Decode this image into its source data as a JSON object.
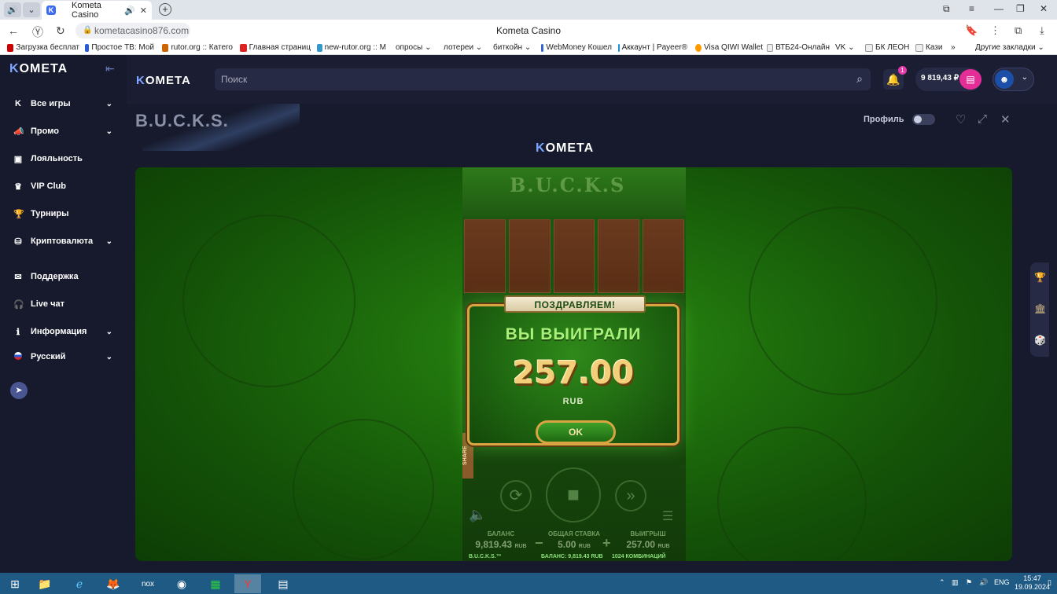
{
  "browser": {
    "tab_title": "Kometa Casino",
    "url": "kometacasino876.com",
    "page_title": "Kometa Casino",
    "bookmarks": [
      "Загрузка бесплат",
      "Простое ТВ: Мой",
      "rutor.org :: Катего",
      "Главная страниц",
      "new-rutor.org :: М",
      "опросы",
      "лотереи",
      "биткойн",
      "WebMoney Кошел",
      "Аккаунт | Payeer®",
      "Visa QIWI Wallet",
      "ВТБ24-Онлайн",
      "VK",
      "БК ЛЕОН",
      "Кази",
      "Другие закладки"
    ]
  },
  "brand": {
    "name_pre": "K",
    "name_rest": "OMETA"
  },
  "sidebar": {
    "items": [
      {
        "label": "Все игры",
        "icon": "kometa-k-icon"
      },
      {
        "label": "Промо",
        "icon": "megaphone-icon"
      },
      {
        "label": "Лояльность",
        "icon": "loyalty-icon"
      },
      {
        "label": "VIP Club",
        "icon": "crown-icon"
      },
      {
        "label": "Турниры",
        "icon": "trophy-icon"
      },
      {
        "label": "Криптовалюта",
        "icon": "crypto-icon"
      },
      {
        "label": "Поддержка",
        "icon": "support-icon"
      },
      {
        "label": "Live чат",
        "icon": "headset-icon"
      },
      {
        "label": "Информация",
        "icon": "info-icon"
      },
      {
        "label": "Русский",
        "icon": "russia-flag-icon"
      }
    ]
  },
  "header": {
    "search_placeholder": "Поиск",
    "notifications_count": "1",
    "balance": "9 819,43 ₽"
  },
  "game": {
    "title": "B.U.C.K.S.",
    "profile_label": "Профиль",
    "slot_name": "B.U.C.K.S",
    "share_label": "SHARE",
    "dialog": {
      "ribbon": "ПОЗДРАВЛЯЕМ!",
      "title": "ВЫ ВЫИГРАЛИ",
      "amount": "257.00",
      "currency": "RUB",
      "ok_label": "OK"
    },
    "stats": {
      "balance_label": "БАЛАНС",
      "balance_value": "9,819.43",
      "bet_label": "ОБЩАЯ СТАВКА",
      "bet_value": "5.00",
      "win_label": "ВЫИГРЫШ",
      "win_value": "257.00",
      "unit": "RUB",
      "footer_game": "B.U.C.K.S.™",
      "footer_balance": "БАЛАНС: 9,819.43 RUB",
      "footer_combos": "1024 КОМБИНАЦИЙ"
    }
  },
  "taskbar": {
    "lang": "ENG",
    "time": "15:47",
    "date": "19.09.2024"
  },
  "colors": {
    "accent": "#e52d97",
    "gold": "#d9a441",
    "dialog_green": "#2f8a1a"
  }
}
